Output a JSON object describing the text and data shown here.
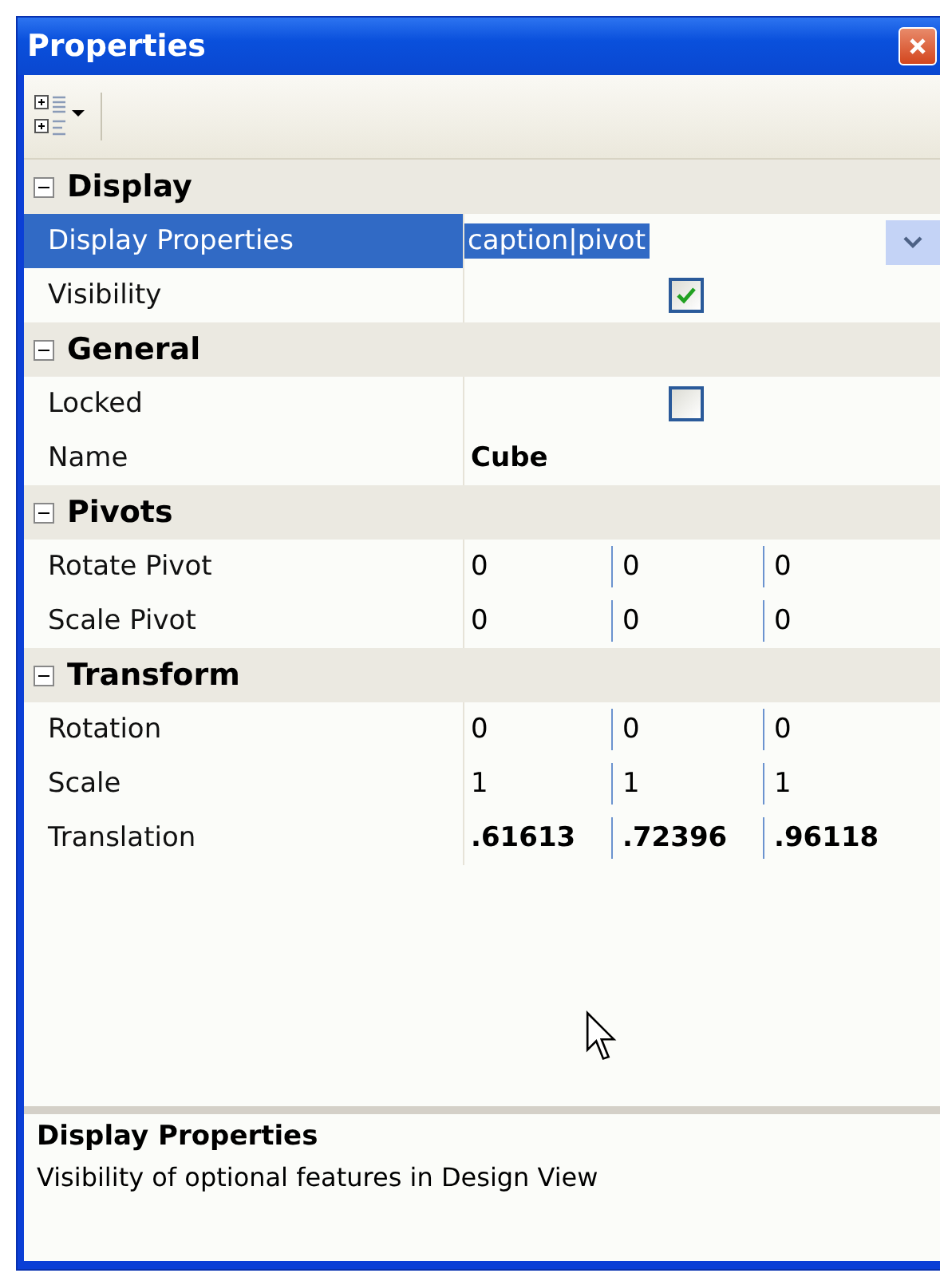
{
  "window": {
    "title": "Properties"
  },
  "categories": [
    {
      "name": "Display",
      "expanded": true,
      "rows": [
        {
          "kind": "dropdown",
          "label": "Display Properties",
          "value": "caption|pivot",
          "selected": true,
          "modified": false
        },
        {
          "kind": "checkbox",
          "label": "Visibility",
          "checked": true,
          "selected": false
        }
      ]
    },
    {
      "name": "General",
      "expanded": true,
      "rows": [
        {
          "kind": "checkbox",
          "label": "Locked",
          "checked": false,
          "selected": false
        },
        {
          "kind": "text",
          "label": "Name",
          "value": "Cube",
          "selected": false,
          "modified": true
        }
      ]
    },
    {
      "name": "Pivots",
      "expanded": true,
      "rows": [
        {
          "kind": "vector",
          "label": "Rotate Pivot",
          "values": [
            "0",
            "0",
            "0"
          ],
          "selected": false,
          "modified": false
        },
        {
          "kind": "vector",
          "label": "Scale Pivot",
          "values": [
            "0",
            "0",
            "0"
          ],
          "selected": false,
          "modified": false
        }
      ]
    },
    {
      "name": "Transform",
      "expanded": true,
      "rows": [
        {
          "kind": "vector",
          "label": "Rotation",
          "values": [
            "0",
            "0",
            "0"
          ],
          "selected": false,
          "modified": false
        },
        {
          "kind": "vector",
          "label": "Scale",
          "values": [
            "1",
            "1",
            "1"
          ],
          "selected": false,
          "modified": false
        },
        {
          "kind": "vector",
          "label": "Translation",
          "values": [
            ".61613",
            ".72396",
            ".96118"
          ],
          "selected": false,
          "modified": true
        }
      ]
    }
  ],
  "description": {
    "title": "Display Properties",
    "text": "Visibility of optional features in Design View"
  }
}
